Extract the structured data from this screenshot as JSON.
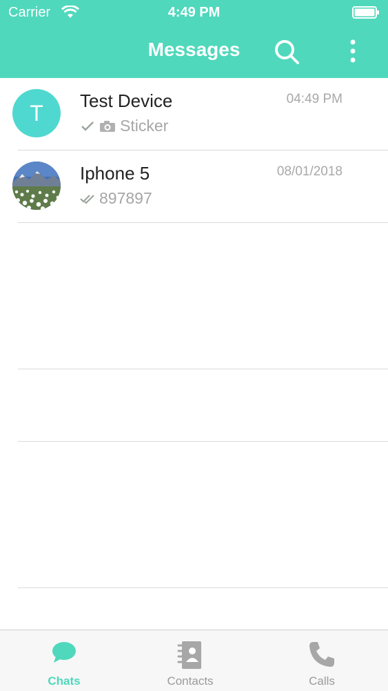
{
  "status_bar": {
    "carrier": "Carrier",
    "time": "4:49 PM"
  },
  "header": {
    "title": "Messages"
  },
  "chats": [
    {
      "name": "Test Device",
      "time": "04:49 PM",
      "avatar_letter": "T",
      "preview": "Sticker",
      "status": "sent-single-tick",
      "attachment_icon": "camera-icon"
    },
    {
      "name": "Iphone 5",
      "time": "08/01/2018",
      "avatar_image": "landscape-photo",
      "preview": "897897",
      "status": "delivered-double-tick"
    }
  ],
  "tabs": [
    {
      "label": "Chats",
      "icon": "chat-bubble-icon",
      "active": true
    },
    {
      "label": "Contacts",
      "icon": "contacts-book-icon",
      "active": false
    },
    {
      "label": "Calls",
      "icon": "phone-icon",
      "active": false
    }
  ],
  "colors": {
    "accent": "#4fd8bc",
    "avatar_bg": "#4fd8d0",
    "secondary_text": "#a6a6a6"
  }
}
